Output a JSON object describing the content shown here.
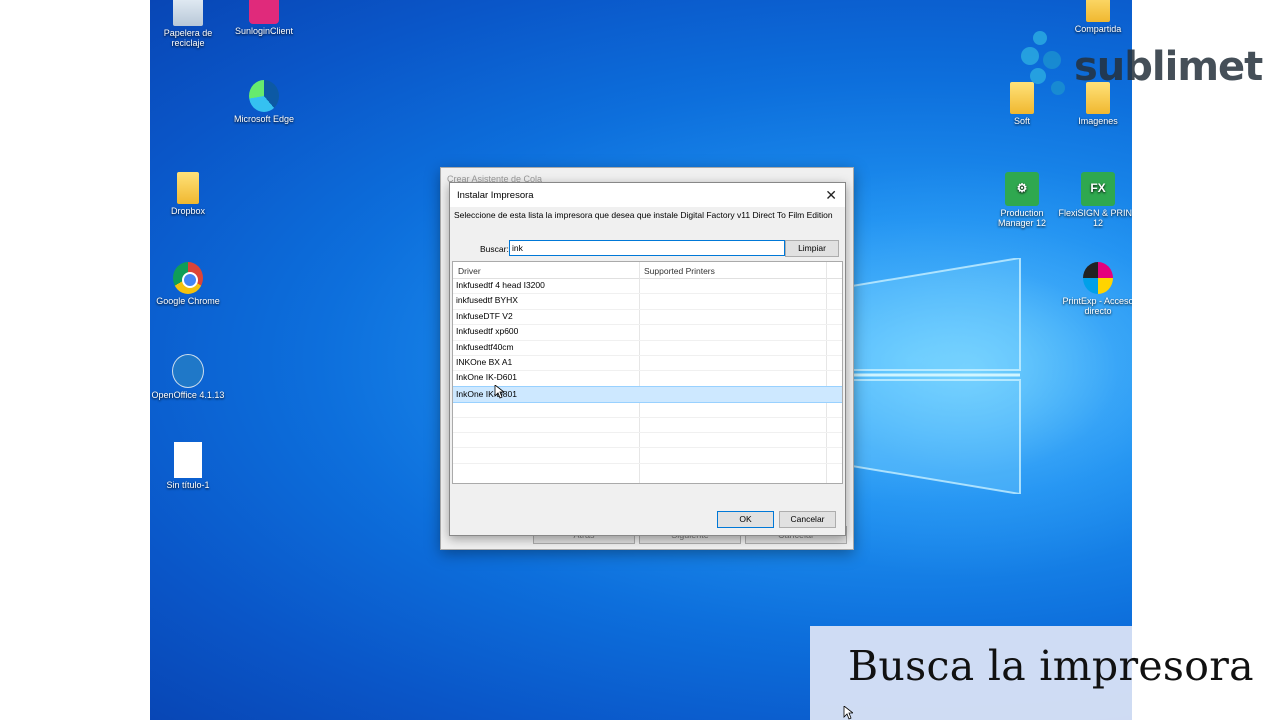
{
  "brand": {
    "name": "sublimet"
  },
  "caption": "Busca la impresora",
  "desktop_icons": {
    "recycle": "Papelera de reciclaje",
    "sunlogin": "SunloginClient",
    "edge": "Microsoft Edge",
    "dropbox": "Dropbox",
    "chrome": "Google Chrome",
    "openoffice": "OpenOffice 4.1.13",
    "untitled": "Sin título-1",
    "compartida": "Compartida",
    "soft": "Soft",
    "imagenes": "Imagenes",
    "production": "Production Manager 12",
    "flexisign": "FlexiSIGN & PRINT 12",
    "printexp": "PrintExp - Acceso directo"
  },
  "back_dialog": {
    "title": "Crear Asistente de Cola",
    "back_label": "Atrás",
    "next_label": "Siguiente",
    "cancel_label": "Cancelar"
  },
  "dialog": {
    "title": "Instalar Impresora",
    "instruction": "Seleccione de esta lista la impresora que desea que instale Digital Factory v11 Direct To Film Edition",
    "search_label": "Buscar:",
    "search_value": "ink",
    "clear_label": "Limpiar",
    "columns": [
      "Driver",
      "Supported Printers"
    ],
    "rows": [
      "Inkfusedtf 4 head I3200",
      "inkfusedtf BYHX",
      "InkfuseDTF V2",
      "Inkfusedtf xp600",
      "Inkfusedtf40cm",
      "INKOne BX A1",
      "InkOne IK-D601",
      "InkOne IK-D801"
    ],
    "selected_index": 7,
    "ok_label": "OK",
    "cancel_label": "Cancelar"
  },
  "colors": {
    "desktop": "#0d6fdc",
    "selection": "#cde8ff",
    "accent": "#0078d7"
  }
}
